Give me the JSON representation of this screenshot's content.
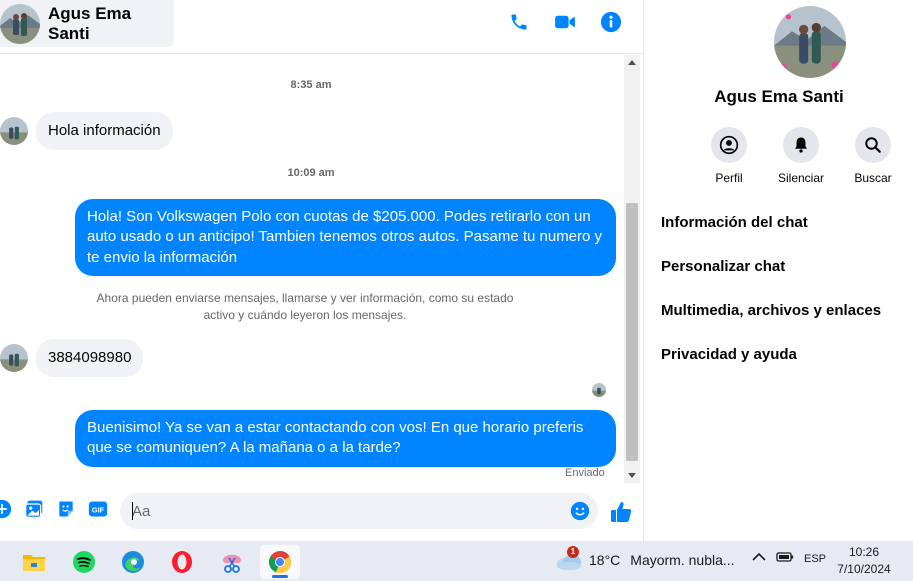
{
  "header": {
    "contact_name": "Agus Ema Santi"
  },
  "messages": {
    "time1": "8:35 am",
    "incoming1": "Hola información",
    "time2": "10:09 am",
    "outgoing1": "Hola! Son Volkswagen Polo con cuotas de $205.000. Podes retirarlo con un auto usado o un anticipo! Tambien tenemos otros autos. Pasame tu numero y te envio la información",
    "system_note": "Ahora pueden enviarse mensajes, llamarse y ver información, como su estado activo y cuándo leyeron los mensajes.",
    "incoming2": "3884098980",
    "outgoing2": "Buenisimo! Ya se van a estar contactando con vos! En que horario preferis que se comuniquen? A la mañana o a la tarde?",
    "sent_status": "Enviado"
  },
  "composer": {
    "placeholder": "Aa",
    "gif_label": "GIF"
  },
  "right_panel": {
    "name": "Agus Ema Santi",
    "actions": [
      {
        "label": "Perfil",
        "icon": "profile-icon"
      },
      {
        "label": "Silenciar",
        "icon": "bell-icon"
      },
      {
        "label": "Buscar",
        "icon": "search-icon"
      }
    ],
    "menu": [
      "Información del chat",
      "Personalizar chat",
      "Multimedia, archivos y enlaces",
      "Privacidad y ayuda"
    ]
  },
  "taskbar": {
    "weather_temp": "18°C",
    "weather_desc": "Mayorm. nubla...",
    "weather_badge": "1",
    "language": "ESP",
    "time": "10:26",
    "date": "7/10/2024"
  },
  "colors": {
    "accent": "#0084ff",
    "bubble_in": "#f0f2f5",
    "taskbar": "#e6ebf3"
  }
}
